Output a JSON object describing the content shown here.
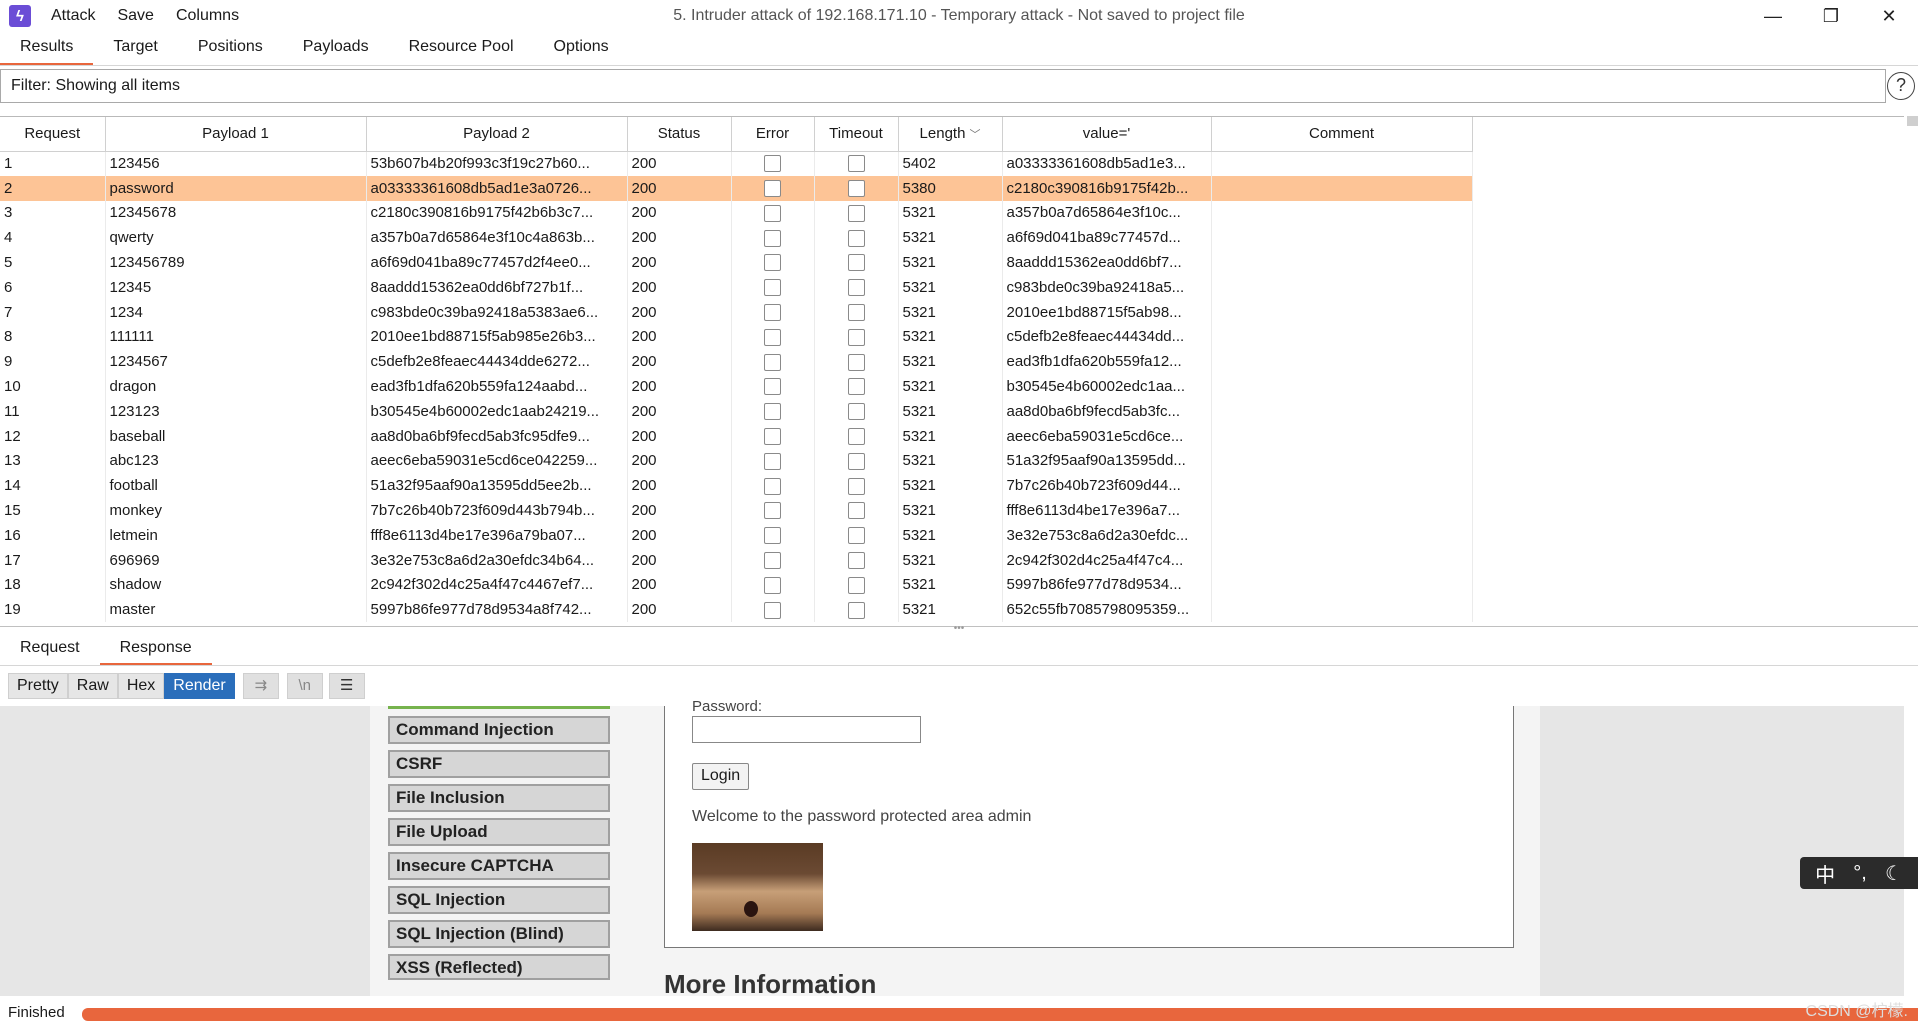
{
  "menubar": {
    "attack": "Attack",
    "save": "Save",
    "columns": "Columns"
  },
  "window": {
    "title": "5. Intruder attack of 192.168.171.10 - Temporary attack - Not saved to project file",
    "minimize": "—",
    "restore": "❐",
    "close": "✕"
  },
  "tabs": [
    {
      "label": "Results",
      "active": true
    },
    {
      "label": "Target"
    },
    {
      "label": "Positions"
    },
    {
      "label": "Payloads"
    },
    {
      "label": "Resource Pool"
    },
    {
      "label": "Options"
    }
  ],
  "filter": {
    "text": "Filter: Showing all items",
    "help": "?"
  },
  "table": {
    "headers": [
      "Request",
      "Payload 1",
      "Payload 2",
      "Status",
      "Error",
      "Timeout",
      "Length",
      "value='",
      "Comment"
    ],
    "sorted_column": "Length",
    "selected_row": 2,
    "rows": [
      {
        "request": "1",
        "p1": "123456",
        "p2": "53b607b4b20f993c3f19c27b60...",
        "status": "200",
        "length": "5402",
        "value": "a03333361608db5ad1e3..."
      },
      {
        "request": "2",
        "p1": "password",
        "p2": "a03333361608db5ad1e3a0726...",
        "status": "200",
        "length": "5380",
        "value": "c2180c390816b9175f42b..."
      },
      {
        "request": "3",
        "p1": "12345678",
        "p2": "c2180c390816b9175f42b6b3c7...",
        "status": "200",
        "length": "5321",
        "value": "a357b0a7d65864e3f10c..."
      },
      {
        "request": "4",
        "p1": "qwerty",
        "p2": "a357b0a7d65864e3f10c4a863b...",
        "status": "200",
        "length": "5321",
        "value": "a6f69d041ba89c77457d..."
      },
      {
        "request": "5",
        "p1": "123456789",
        "p2": "a6f69d041ba89c77457d2f4ee0...",
        "status": "200",
        "length": "5321",
        "value": "8aaddd15362ea0dd6bf7..."
      },
      {
        "request": "6",
        "p1": "12345",
        "p2": "8aaddd15362ea0dd6bf727b1f...",
        "status": "200",
        "length": "5321",
        "value": "c983bde0c39ba92418a5..."
      },
      {
        "request": "7",
        "p1": "1234",
        "p2": "c983bde0c39ba92418a5383ae6...",
        "status": "200",
        "length": "5321",
        "value": "2010ee1bd88715f5ab98..."
      },
      {
        "request": "8",
        "p1": "111111",
        "p2": "2010ee1bd88715f5ab985e26b3...",
        "status": "200",
        "length": "5321",
        "value": "c5defb2e8feaec44434dd..."
      },
      {
        "request": "9",
        "p1": "1234567",
        "p2": "c5defb2e8feaec44434dde6272...",
        "status": "200",
        "length": "5321",
        "value": "ead3fb1dfa620b559fa12..."
      },
      {
        "request": "10",
        "p1": "dragon",
        "p2": "ead3fb1dfa620b559fa124aabd...",
        "status": "200",
        "length": "5321",
        "value": "b30545e4b60002edc1aa..."
      },
      {
        "request": "11",
        "p1": "123123",
        "p2": "b30545e4b60002edc1aab24219...",
        "status": "200",
        "length": "5321",
        "value": "aa8d0ba6bf9fecd5ab3fc..."
      },
      {
        "request": "12",
        "p1": "baseball",
        "p2": "aa8d0ba6bf9fecd5ab3fc95dfe9...",
        "status": "200",
        "length": "5321",
        "value": "aeec6eba59031e5cd6ce..."
      },
      {
        "request": "13",
        "p1": "abc123",
        "p2": "aeec6eba59031e5cd6ce042259...",
        "status": "200",
        "length": "5321",
        "value": "51a32f95aaf90a13595dd..."
      },
      {
        "request": "14",
        "p1": "football",
        "p2": "51a32f95aaf90a13595dd5ee2b...",
        "status": "200",
        "length": "5321",
        "value": "7b7c26b40b723f609d44..."
      },
      {
        "request": "15",
        "p1": "monkey",
        "p2": "7b7c26b40b723f609d443b794b...",
        "status": "200",
        "length": "5321",
        "value": "fff8e6113d4be17e396a7..."
      },
      {
        "request": "16",
        "p1": "letmein",
        "p2": "fff8e6113d4be17e396a79ba07...",
        "status": "200",
        "length": "5321",
        "value": "3e32e753c8a6d2a30efdc..."
      },
      {
        "request": "17",
        "p1": "696969",
        "p2": "3e32e753c8a6d2a30efdc34b64...",
        "status": "200",
        "length": "5321",
        "value": "2c942f302d4c25a4f47c4..."
      },
      {
        "request": "18",
        "p1": "shadow",
        "p2": "2c942f302d4c25a4f47c4467ef7...",
        "status": "200",
        "length": "5321",
        "value": "5997b86fe977d78d9534..."
      },
      {
        "request": "19",
        "p1": "master",
        "p2": "5997b86fe977d78d9534a8f742...",
        "status": "200",
        "length": "5321",
        "value": "652c55fb7085798095359..."
      }
    ]
  },
  "rr_tabs": [
    {
      "label": "Request"
    },
    {
      "label": "Response",
      "active": true
    }
  ],
  "viewbar": {
    "pretty": "Pretty",
    "raw": "Raw",
    "hex": "Hex",
    "render": "Render",
    "active": "Render"
  },
  "render": {
    "menu": [
      "Command Injection",
      "CSRF",
      "File Inclusion",
      "File Upload",
      "Insecure CAPTCHA",
      "SQL Injection",
      "SQL Injection (Blind)",
      "XSS (Reflected)"
    ],
    "password_label": "Password:",
    "login_button": "Login",
    "welcome": "Welcome to the password protected area admin",
    "more_info": "More Information"
  },
  "status": {
    "text": "Finished",
    "progress_percent": 100
  },
  "ime": {
    "char": "中",
    "punct": "°,",
    "moon": "☾"
  },
  "watermark": "CSDN @柠檬.",
  "colors": {
    "accent": "#e8663d",
    "selected_row": "#fdc496",
    "render_active": "#2a6ebb"
  }
}
